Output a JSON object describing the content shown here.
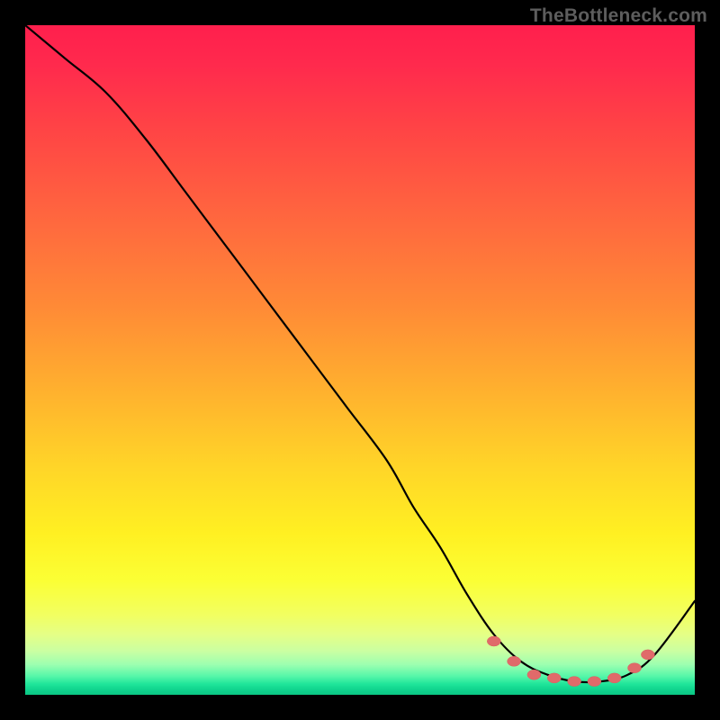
{
  "watermark": "TheBottleneck.com",
  "colors": {
    "curve": "#000000",
    "dot": "#e06a6a",
    "background": "#000000"
  },
  "chart_data": {
    "type": "line",
    "title": "",
    "xlabel": "",
    "ylabel": "",
    "xlim": [
      0,
      100
    ],
    "ylim": [
      0,
      100
    ],
    "grid": false,
    "legend": false,
    "note": "Values are approximate percentage positions read from the plot. x is left→right, y is bottom→top (0 at bottom).",
    "series": [
      {
        "name": "curve",
        "x": [
          0,
          6,
          12,
          18,
          24,
          30,
          36,
          42,
          48,
          54,
          58,
          62,
          66,
          70,
          74,
          78,
          82,
          86,
          90,
          94,
          100
        ],
        "y": [
          100,
          95,
          90,
          83,
          75,
          67,
          59,
          51,
          43,
          35,
          28,
          22,
          15,
          9,
          5,
          3,
          2,
          2,
          3,
          6,
          14
        ]
      }
    ],
    "marked_points": {
      "name": "highlighted-dots",
      "x": [
        70,
        73,
        76,
        79,
        82,
        85,
        88,
        91,
        93
      ],
      "y": [
        8,
        5,
        3,
        2.5,
        2,
        2,
        2.5,
        4,
        6
      ]
    }
  }
}
